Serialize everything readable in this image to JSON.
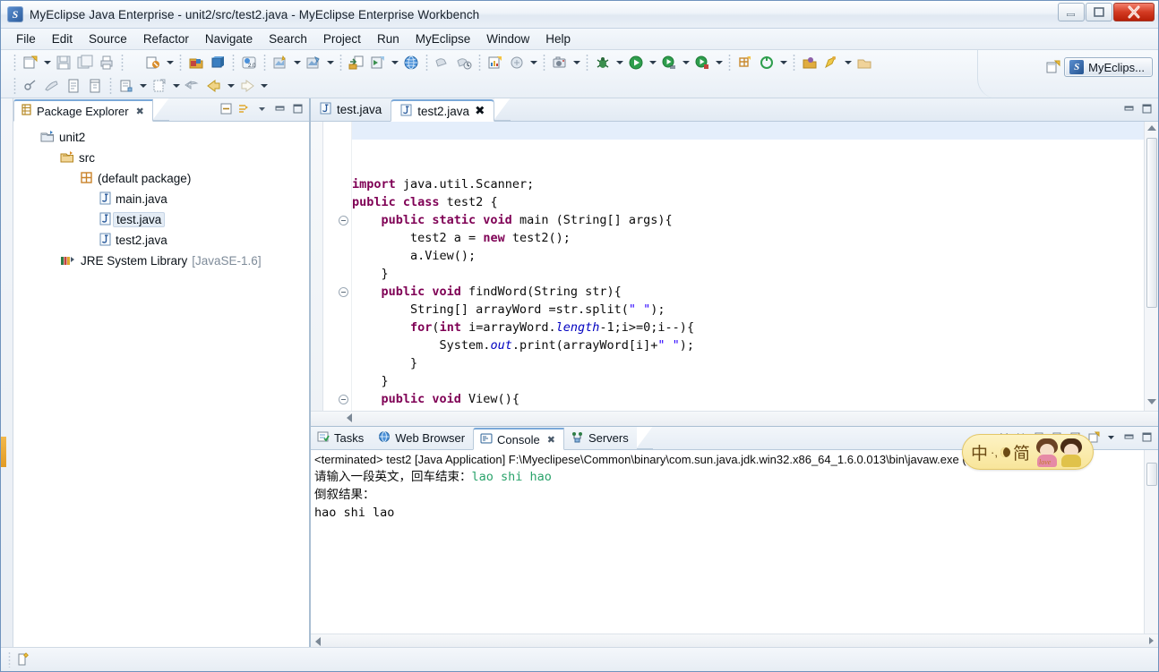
{
  "window": {
    "title": "MyEclipse Java Enterprise -  unit2/src/test2.java - MyEclipse Enterprise Workbench",
    "app_icon": "myeclipse-logo-icon",
    "minimize_label": "—",
    "maximize_label": "□",
    "close_label": "✕"
  },
  "menubar": {
    "items": [
      {
        "label": "File"
      },
      {
        "label": "Edit"
      },
      {
        "label": "Source"
      },
      {
        "label": "Refactor"
      },
      {
        "label": "Navigate"
      },
      {
        "label": "Search"
      },
      {
        "label": "Project"
      },
      {
        "label": "Run"
      },
      {
        "label": "MyEclipse"
      },
      {
        "label": "Window"
      },
      {
        "label": "Help"
      }
    ]
  },
  "toolbar": {
    "perspective_button_label": "MyEclips...",
    "perspective_icon": "myeclipse-perspective-icon",
    "open_perspective_icon": "open-perspective-icon"
  },
  "package_explorer": {
    "tab_label": "Package Explorer",
    "tab_close_icon": "close-icon",
    "tools": [
      "collapse-all-icon",
      "link-with-editor-icon",
      "view-menu-icon",
      "minimize-icon",
      "maximize-icon"
    ],
    "tree": [
      {
        "label": "unit2",
        "icon": "java-project-icon",
        "indent": 0,
        "selected": false,
        "suffix": ""
      },
      {
        "label": "src",
        "icon": "source-folder-icon",
        "indent": 1,
        "selected": false,
        "suffix": ""
      },
      {
        "label": "(default package)",
        "icon": "package-icon",
        "indent": 2,
        "selected": false,
        "suffix": ""
      },
      {
        "label": "main.java",
        "icon": "java-file-icon",
        "indent": 3,
        "selected": false,
        "suffix": ""
      },
      {
        "label": "test.java",
        "icon": "java-file-icon",
        "indent": 3,
        "selected": true,
        "suffix": ""
      },
      {
        "label": "test2.java",
        "icon": "java-file-icon",
        "indent": 3,
        "selected": false,
        "suffix": ""
      },
      {
        "label": "JRE System Library",
        "icon": "jre-library-icon",
        "indent": 1,
        "selected": false,
        "suffix": "[JavaSE-1.6]"
      }
    ]
  },
  "editor": {
    "tabs": [
      {
        "label": "test.java",
        "icon": "java-file-icon",
        "active": false,
        "closable": false
      },
      {
        "label": "test2.java",
        "icon": "java-file-icon",
        "active": true,
        "closable": true
      }
    ],
    "tools": [
      "minimize-icon",
      "maximize-icon"
    ],
    "code_lines": [
      {
        "text": "",
        "fold": false,
        "highlight": true
      },
      {
        "text": "",
        "fold": false,
        "highlight": false
      },
      {
        "text": "",
        "fold": false,
        "highlight": false
      },
      {
        "text": "import java.util.Scanner;",
        "fold": false,
        "highlight": false
      },
      {
        "text": "public class test2 {",
        "fold": false,
        "highlight": false
      },
      {
        "text": "    public static void main (String[] args){",
        "fold": true,
        "highlight": false
      },
      {
        "text": "        test2 a = new test2();",
        "fold": false,
        "highlight": false
      },
      {
        "text": "        a.View();",
        "fold": false,
        "highlight": false
      },
      {
        "text": "    }",
        "fold": false,
        "highlight": false
      },
      {
        "text": "    public void findWord(String str){",
        "fold": true,
        "highlight": false
      },
      {
        "text": "        String[] arrayWord =str.split(\" \");",
        "fold": false,
        "highlight": false
      },
      {
        "text": "        for(int i=arrayWord.length-1;i>=0;i--){",
        "fold": false,
        "highlight": false
      },
      {
        "text": "            System.out.print(arrayWord[i]+\" \");",
        "fold": false,
        "highlight": false
      },
      {
        "text": "        }",
        "fold": false,
        "highlight": false
      },
      {
        "text": "    }",
        "fold": false,
        "highlight": false
      },
      {
        "text": "    public void View(){",
        "fold": true,
        "highlight": false
      }
    ]
  },
  "bottom_panel": {
    "tabs": [
      {
        "label": "Tasks",
        "icon": "tasks-icon",
        "active": false,
        "closable": false
      },
      {
        "label": "Web Browser",
        "icon": "web-browser-icon",
        "active": false,
        "closable": false
      },
      {
        "label": "Console",
        "icon": "console-icon",
        "active": true,
        "closable": true
      },
      {
        "label": "Servers",
        "icon": "servers-icon",
        "active": false,
        "closable": false
      }
    ],
    "tools": [
      "terminate-icon",
      "remove-launch-icon",
      "remove-all-terminated-icon",
      "clear-console-icon",
      "scroll-lock-icon",
      "pin-console-icon",
      "display-selected-console-icon",
      "open-console-icon",
      "view-menu-icon",
      "minimize-icon",
      "maximize-icon"
    ]
  },
  "console": {
    "header": "<terminated> test2 [Java Application] F:\\Myeclipese\\Common\\binary\\com.sun.java.jdk.win32.x86_64_1.6.0.013\\bin\\javaw.exe (20",
    "lines": [
      {
        "prompt": "请输入一段英文，回车结束：",
        "input": "lao shi hao"
      },
      {
        "prompt": "倒叙结果：",
        "input": ""
      },
      {
        "prompt": "hao shi lao",
        "input": ""
      }
    ]
  },
  "ime_bar": {
    "mode_label": "中",
    "punctuation_label": "·,",
    "shape_icon": "half-width-icon",
    "script_label": "简",
    "skin_icon": "ime-skin-girls-icon"
  },
  "statusbar": {
    "icon": "writable-insert-icon",
    "text": ""
  },
  "colors": {
    "keyword": "#7f0055",
    "string": "#2a00ff",
    "field": "#0000c0",
    "console_input": "#2aa36b",
    "selection": "#e4eefb",
    "accent": "#7aa8d8"
  }
}
